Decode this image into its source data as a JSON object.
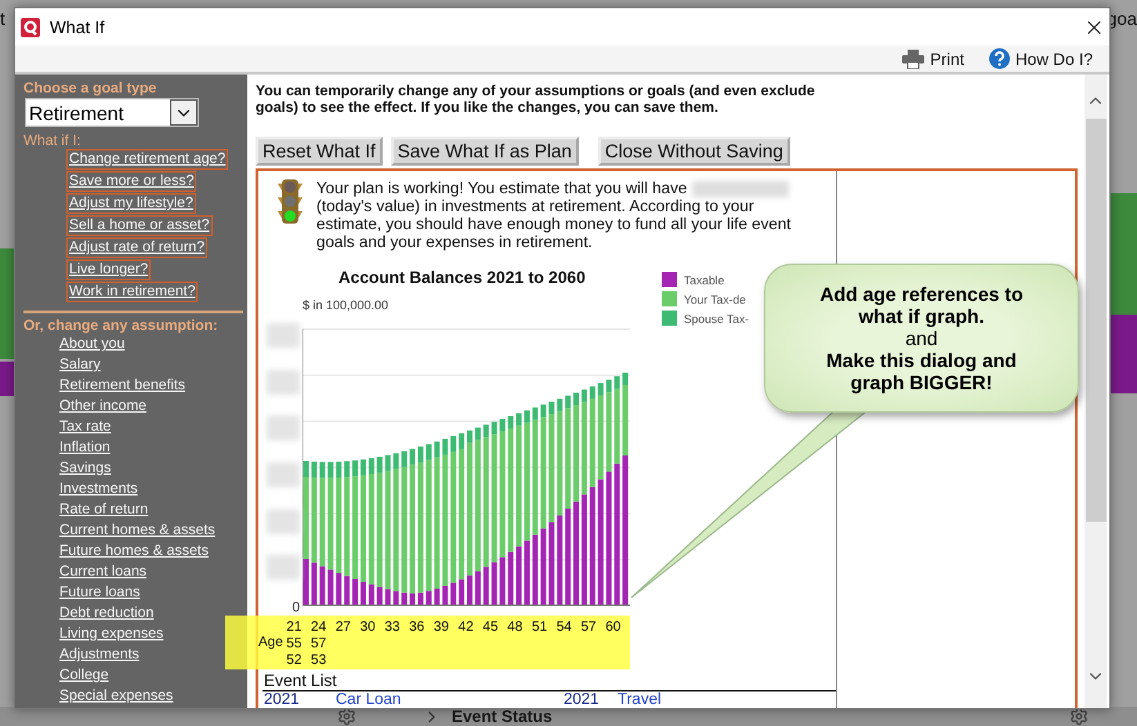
{
  "background": {
    "fragment_left": "t",
    "fragment_right": "goa",
    "status": {
      "label": "Event Status"
    }
  },
  "window": {
    "title": "What If"
  },
  "toolbar": [
    {
      "kind": "print",
      "label": "Print"
    },
    {
      "kind": "help",
      "label": "How Do I?"
    }
  ],
  "sidebar": {
    "goal_heading": "Choose a goal type",
    "goal_select": {
      "value": "Retirement"
    },
    "what_if_heading": "What if I:",
    "what_if_links": [
      "Change retirement age?",
      "Save more or less?",
      "Adjust my lifestyle?",
      "Sell a home or asset?",
      "Adjust rate of return?",
      "Live longer?",
      "Work in retirement?"
    ],
    "assumption_heading": "Or, change any assumption:",
    "assumption_links": [
      "About you",
      "Salary",
      "Retirement benefits",
      "Other income",
      "Tax rate",
      "Inflation",
      "Savings",
      "Investments",
      "Rate of return",
      "Current homes & assets",
      "Future homes & assets",
      "Current loans",
      "Future loans",
      "Debt reduction",
      "Living expenses",
      "Adjustments",
      "College",
      "Special expenses"
    ]
  },
  "intro": "You can temporarily change any of your assumptions or goals (and even exclude goals) to see the effect. If you like the changes, you can save them.",
  "buttons": [
    "Reset What If",
    "Save What If as Plan",
    "Close Without Saving"
  ],
  "plan": {
    "message_start": "Your plan is working! You estimate that you will have",
    "message_end": "(today's value) in investments at retirement. According to your estimate, you should have enough money to fund all your life event goals and your expenses in retirement."
  },
  "chart": {
    "title": "Account Balances 2021 to 2060",
    "unit": "$ in 100,000.00",
    "zero": "0",
    "legend": [
      {
        "label": "Taxable",
        "color": "#a424b4"
      },
      {
        "label": "Your Tax-de",
        "color": "#6acd6a"
      },
      {
        "label": "Spouse Tax-",
        "color": "#3dbb73"
      }
    ],
    "ages": {
      "label": "Age",
      "rows": [
        [
          "21",
          "24",
          "27",
          "30",
          "33",
          "36",
          "39",
          "42",
          "45",
          "48",
          "51",
          "54",
          "57",
          "60"
        ],
        [
          "55",
          "57"
        ],
        [
          "52",
          "53"
        ]
      ]
    }
  },
  "event_list": {
    "title": "Event List",
    "rows": [
      {
        "year": "2021",
        "name": "Car Loan"
      },
      {
        "year": "2021",
        "name": "Travel"
      }
    ]
  },
  "callout": {
    "lines": [
      {
        "text": "Add age references to what if graph.",
        "bold": true
      },
      {
        "text": "and",
        "bold": false
      },
      {
        "text": "Make this dialog and graph BIGGER!",
        "bold": true
      }
    ]
  }
}
